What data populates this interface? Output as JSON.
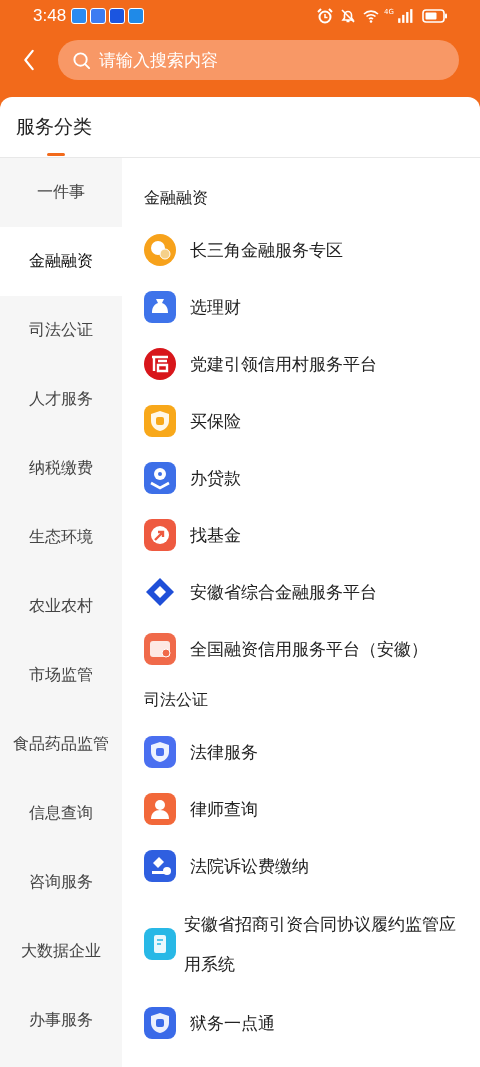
{
  "status_bar": {
    "time": "3:48",
    "network": "4G"
  },
  "search": {
    "placeholder": "请输入搜索内容"
  },
  "title": "服务分类",
  "sidebar": {
    "items": [
      {
        "label": "一件事",
        "selected": false
      },
      {
        "label": "金融融资",
        "selected": true
      },
      {
        "label": "司法公证",
        "selected": false
      },
      {
        "label": "人才服务",
        "selected": false
      },
      {
        "label": "纳税缴费",
        "selected": false
      },
      {
        "label": "生态环境",
        "selected": false
      },
      {
        "label": "农业农村",
        "selected": false
      },
      {
        "label": "市场监管",
        "selected": false
      },
      {
        "label": "食品药品监管",
        "selected": false
      },
      {
        "label": "信息查询",
        "selected": false
      },
      {
        "label": "咨询服务",
        "selected": false
      },
      {
        "label": "大数据企业",
        "selected": false
      },
      {
        "label": "办事服务",
        "selected": false
      }
    ]
  },
  "sections": [
    {
      "title": "金融融资",
      "items": [
        {
          "label": "长三角金融服务专区",
          "color": "#f7a21b"
        },
        {
          "label": "选理财",
          "color": "#3e73ea"
        },
        {
          "label": "党建引领信用村服务平台",
          "color": "#d8161b"
        },
        {
          "label": "买保险",
          "color": "#f8a81a"
        },
        {
          "label": "办贷款",
          "color": "#3d6fe8"
        },
        {
          "label": "找基金",
          "color": "#ee5a40"
        },
        {
          "label": "安徽省综合金融服务平台",
          "color": "#1f4fd8"
        },
        {
          "label": "全国融资信用服务平台（安徽）",
          "color": "#f06a4a"
        }
      ]
    },
    {
      "title": "司法公证",
      "items": [
        {
          "label": "法律服务",
          "color": "#4a6ff0"
        },
        {
          "label": "律师查询",
          "color": "#f2683a"
        },
        {
          "label": "法院诉讼费缴纳",
          "color": "#2f5fe0"
        },
        {
          "label": "安徽省招商引资合同协议履约监管应用系统",
          "color": "#28b8e6"
        },
        {
          "label": "狱务一点通",
          "color": "#3a6ae8"
        }
      ]
    }
  ]
}
